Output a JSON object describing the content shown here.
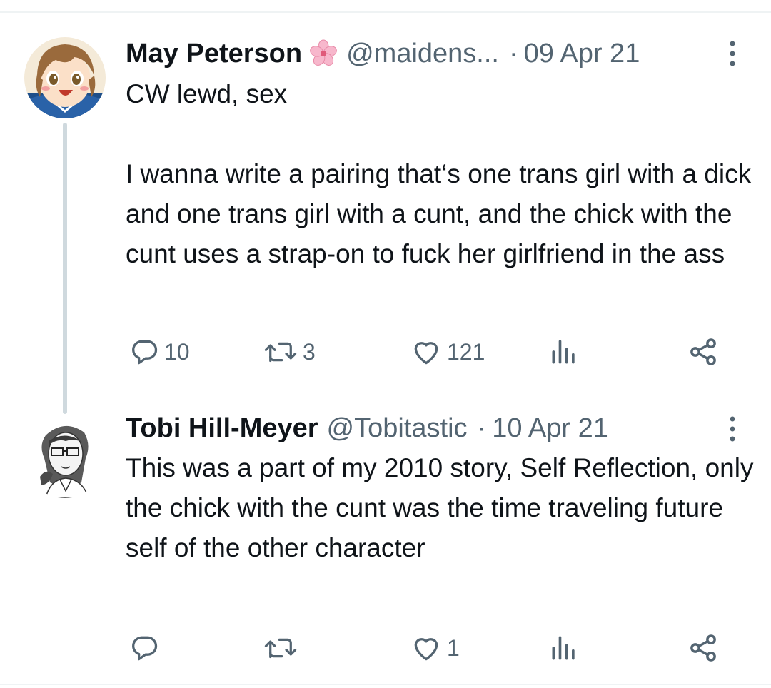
{
  "tweets": [
    {
      "name": "May Peterson",
      "has_flower_emoji": true,
      "handle": "@maidens...",
      "separator": "·",
      "date": "09 Apr 21",
      "text": "CW lewd, sex\n\nI wanna write a pairing that‘s one trans girl with a dick and one trans girl with a cunt, and the chick with the cunt uses a strap-on to fuck her girlfriend in the ass",
      "replies": "10",
      "retweets": "3",
      "likes": "121",
      "views": ""
    },
    {
      "name": "Tobi Hill-Meyer",
      "handle": "@Tobitastic",
      "separator": "·",
      "date": "10 Apr 21",
      "text": "This was a part of my 2010 story, Self Reflection, only the chick with the cunt was the time traveling future self of the other character",
      "replies": "",
      "retweets": "",
      "likes": "1",
      "views": ""
    }
  ],
  "icons": {
    "reply": "reply-icon",
    "retweet": "retweet-icon",
    "like": "heart-icon",
    "views": "analytics-icon",
    "share": "share-icon",
    "more": "more-icon",
    "flower": "cherry-blossom-icon"
  },
  "colors": {
    "text": "#0f1419",
    "secondary": "#536471",
    "thread_line": "#cfd9de",
    "divider": "#eff3f4"
  }
}
